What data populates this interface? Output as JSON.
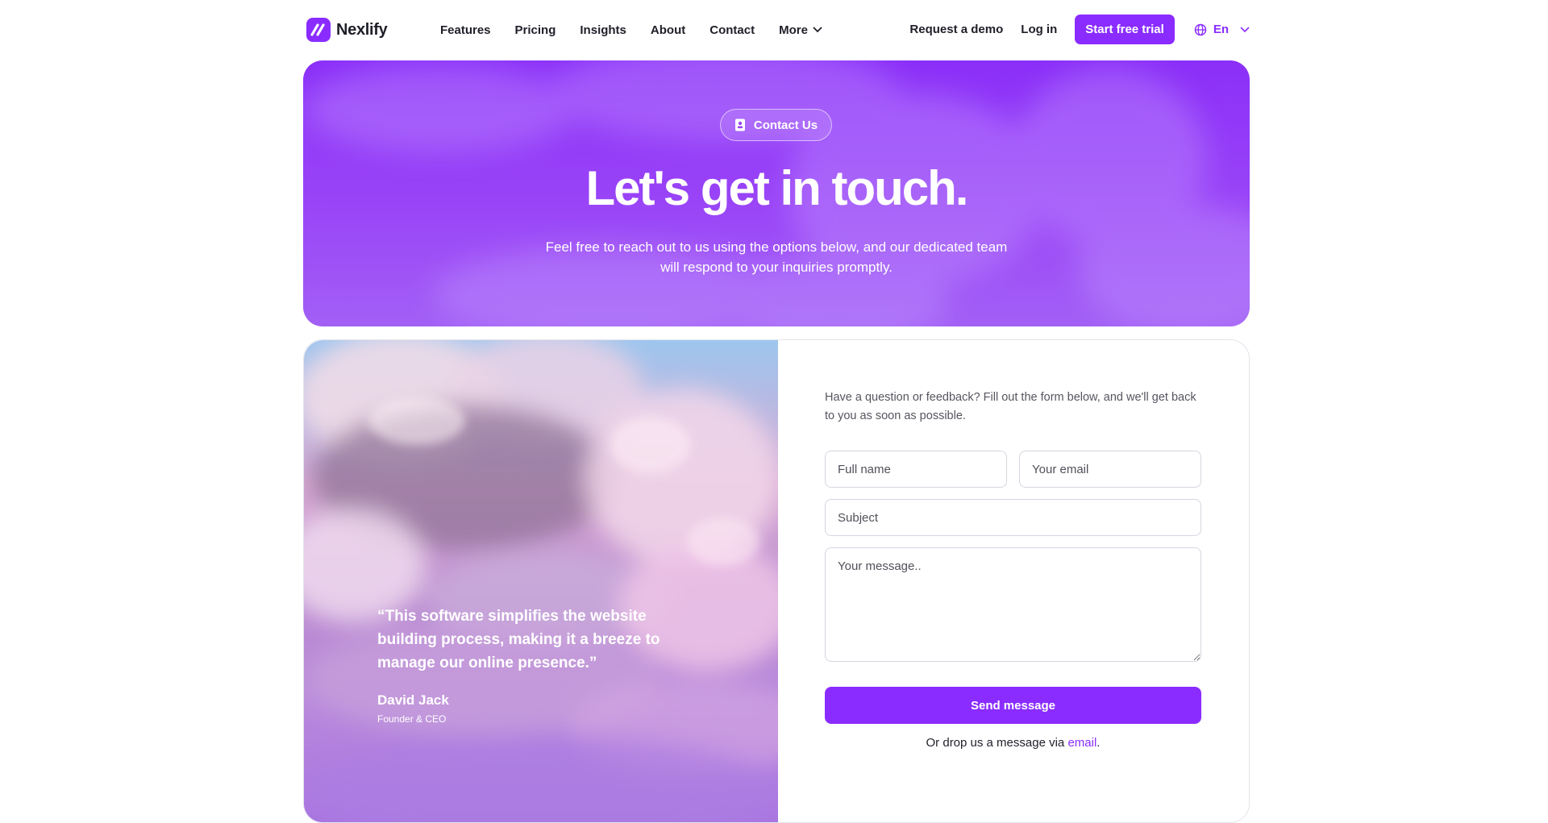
{
  "colors": {
    "accent": "#8a2cff",
    "text": "#1f1f29",
    "muted": "#55555f",
    "border": "#d6d6e0"
  },
  "brand": {
    "name": "Nexlify",
    "icon": "logo-mark-icon"
  },
  "nav": {
    "links": [
      "Features",
      "Pricing",
      "Insights",
      "About",
      "Contact"
    ],
    "more_label": "More",
    "request_demo": "Request a demo",
    "login": "Log in",
    "trial_button": "Start free trial",
    "language": "En"
  },
  "hero": {
    "pill_label": "Contact Us",
    "pill_icon": "contact-card-icon",
    "title": "Let's get in touch.",
    "subtitle": "Feel free to reach out to us using the options below, and our dedicated team will respond to your inquiries promptly."
  },
  "testimonial": {
    "quote": "“This software simplifies the website building process, making it a breeze to manage our online presence.”",
    "author": "David Jack",
    "role": "Founder & CEO"
  },
  "form": {
    "intro": "Have a question or feedback? Fill out the form below, and we'll get back to you as soon as possible.",
    "name_placeholder": "Full name",
    "email_placeholder": "Your email",
    "subject_placeholder": "Subject",
    "message_placeholder": "Your message..",
    "send_label": "Send message",
    "drop_prefix": "Or drop us a message via ",
    "drop_link": "email",
    "drop_suffix": "."
  }
}
